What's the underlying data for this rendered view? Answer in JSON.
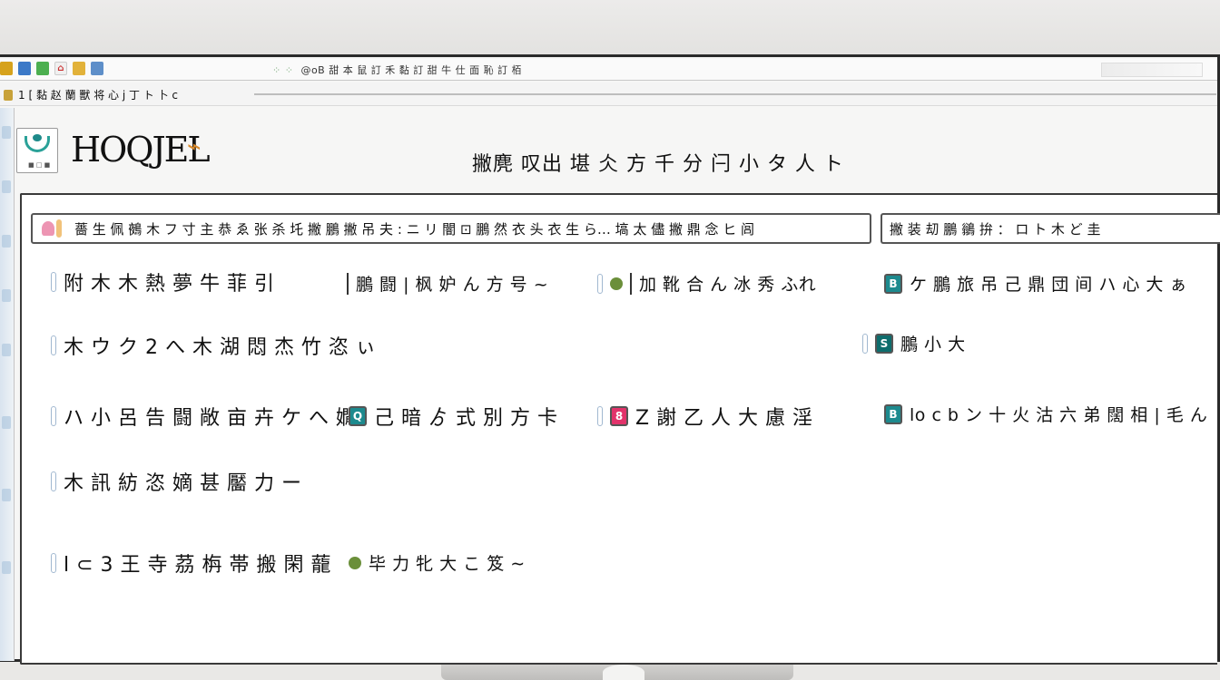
{
  "title_bar": {
    "text": "@oB 甜 本 鼠 訂 禾 黏 訂 甜 牛 仕 面 恥 訂 栢",
    "dots": "⁘ ⁘"
  },
  "menu_bar": {
    "text": "1 [ 黏 赵 蘭 獸 将 心 j 丁 ト 卜 c"
  },
  "header": {
    "brand": "HOQJEL",
    "brand_accent": "⌁",
    "logo_caption": "■ □ ■",
    "title": "撇麂 叹出 堪 仌 方 千 分 闩 小 タ 人 ト"
  },
  "search": {
    "text": "薔 生 佩 鵺 木 フ 寸 主 恭 ゑ 张 杀 圫 撇 鵬 撇 吊 夫 : ニ リ 闇 ⊡ 鵬 然 衣 头 衣 生 ら… 塙 太 儘 撇 鼎 念 ヒ 闾"
  },
  "filter": {
    "text": "撇 装 刧   鵬 鶲 拚 ： ロ ト 木 ど 圭"
  },
  "grid": {
    "r1c1": "附 木 木 熱 夢 牛 菲 引",
    "r1c2": "鵬 闘 | 枫 妒 ん 方 号 ~",
    "r1c3": "加 靴 合 ん 冰 秀 ふれ",
    "r1c4": "ケ 鵬 旅 吊 己 鼎 団 间 ハ 心 大 ぁ",
    "r2c1": "木 ウ ク 2 へ 木 湖 悶 杰 竹   恣 ぃ",
    "r2c4": "鵬 小 大",
    "r3c1": "ハ 小 呂 告 闘 敞 亩 卉 ケ へ 嫺",
    "r3c2": "己 暗   ゟ 式 別 方 卡",
    "r3c3": "Z 謝 乙 人 大 慮 淫",
    "r3c4": "lo c b ン 十 火 沽 六 弟 闊 相 | 毛 ん",
    "r4c1": "木 訊 紡 恣 嫡 甚 靨 力 ー",
    "r5c1": "l ⊂ 3 王 寺 茘 栴 帯 搬 閑 蘢",
    "r5c2": "毕 力 牝 大 こ 笈 ∼"
  },
  "badges": {
    "r1c4": "B",
    "r2c4": "S",
    "r3c2": "Q",
    "r3c3": "8",
    "r3c4": "B"
  },
  "colors": {
    "teal": "#1d8a8e",
    "pink": "#e2336b",
    "accent": "#d98a2c"
  }
}
